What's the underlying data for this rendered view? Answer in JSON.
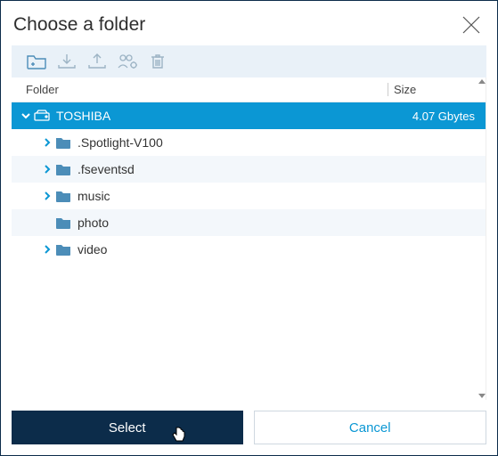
{
  "title": "Choose a folder",
  "columns": {
    "folder": "Folder",
    "size": "Size"
  },
  "rows": [
    {
      "label": "TOSHIBA",
      "size": "4.07 Gbytes",
      "depth": 0,
      "expanded": true,
      "selected": true,
      "kind": "drive",
      "hasChildren": true
    },
    {
      "label": ".Spotlight-V100",
      "size": "",
      "depth": 1,
      "expanded": false,
      "selected": false,
      "kind": "folder",
      "hasChildren": true
    },
    {
      "label": ".fseventsd",
      "size": "",
      "depth": 1,
      "expanded": false,
      "selected": false,
      "kind": "folder",
      "hasChildren": true,
      "alt": true
    },
    {
      "label": "music",
      "size": "",
      "depth": 1,
      "expanded": false,
      "selected": false,
      "kind": "folder",
      "hasChildren": true
    },
    {
      "label": "photo",
      "size": "",
      "depth": 1,
      "expanded": false,
      "selected": false,
      "kind": "folder",
      "hasChildren": false,
      "alt": true
    },
    {
      "label": "video",
      "size": "",
      "depth": 1,
      "expanded": false,
      "selected": false,
      "kind": "folder",
      "hasChildren": true
    }
  ],
  "buttons": {
    "select": "Select",
    "cancel": "Cancel"
  },
  "colors": {
    "accent": "#0b97d4",
    "darkBlue": "#0c2c4a",
    "toolbarBg": "#e9f1f8"
  }
}
